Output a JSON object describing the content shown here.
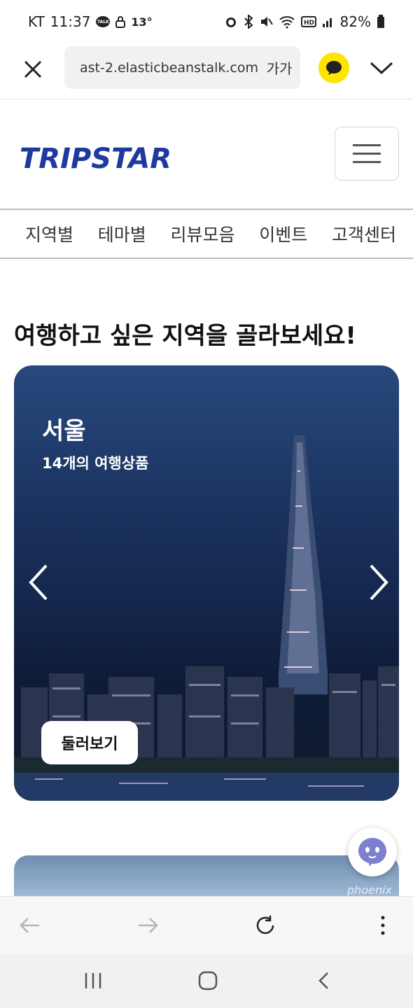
{
  "status_bar": {
    "carrier": "KT",
    "time": "11:37",
    "talk_icon": "TALK",
    "temperature": "13°",
    "battery": "82%"
  },
  "browser": {
    "url": "ast-2.elasticbeanstalk.com",
    "text_size_label": "가가"
  },
  "site": {
    "logo": "TRIPSTAR",
    "nav": [
      "지역별",
      "테마별",
      "리뷰모음",
      "이벤트",
      "고객센터"
    ]
  },
  "main": {
    "section_title": "여행하고 싶은 지역을 골라보세요!",
    "card": {
      "city": "서울",
      "count": "14개의 여행상품",
      "browse_label": "둘러보기"
    },
    "card2_watermark": "phoenix"
  },
  "icons": {
    "close": "close-icon",
    "kakao": "kakao-talk-icon",
    "chevron": "chevron-down-icon",
    "menu": "hamburger-menu-icon",
    "prev": "chevron-left-icon",
    "next": "chevron-right-icon",
    "chatbot": "chatbot-icon"
  },
  "colors": {
    "brand": "#1e3a9e",
    "kakao": "#fee500"
  }
}
